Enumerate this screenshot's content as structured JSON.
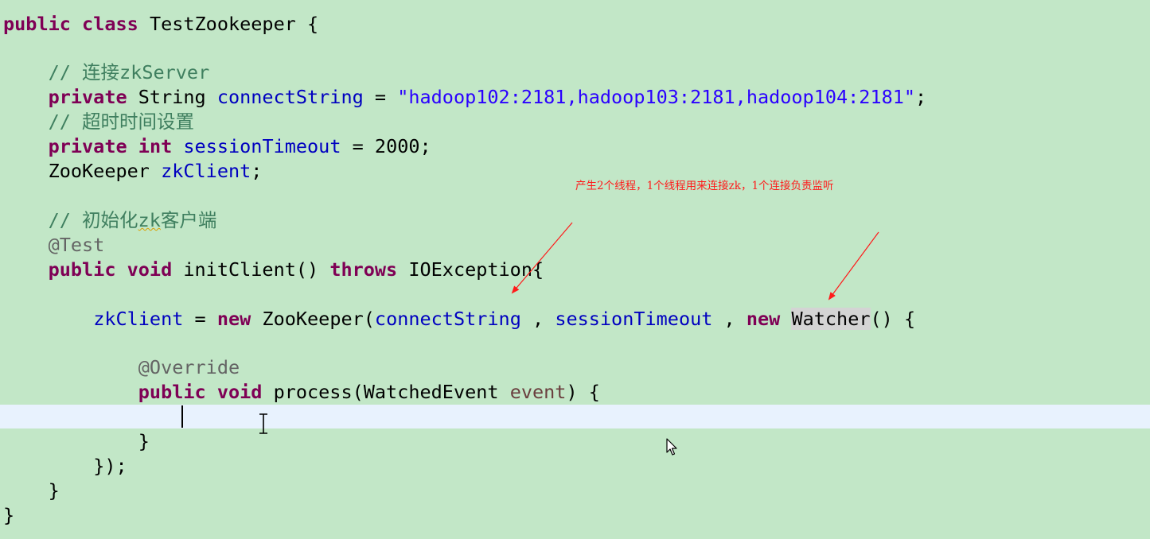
{
  "code": {
    "l1": {
      "kw_public": "public",
      "kw_class": "class",
      "name": " TestZookeeper {"
    },
    "l3": {
      "comment": "// 连接zkServer"
    },
    "l4": {
      "kw_private": "private",
      "type": " String ",
      "field": "connectString",
      "eq": " = ",
      "value": "\"hadoop102:2181,hadoop103:2181,hadoop104:2181\"",
      "end": ";"
    },
    "l5": {
      "comment": "// 超时时间设置"
    },
    "l6": {
      "kw_private": "private",
      "kw_int": "int",
      "field": "sessionTimeout",
      "rest": " = 2000;"
    },
    "l7": {
      "type": "ZooKeeper ",
      "field": "zkClient",
      "end": ";"
    },
    "l9": {
      "comment_a": "// 初始化",
      "comment_b": "zk",
      "comment_c": "客户端"
    },
    "l10": {
      "annotation": "@Test"
    },
    "l11": {
      "kw_public": "public",
      "kw_void": "void",
      "method": " initClient() ",
      "kw_throws": "throws",
      "rest": " IOException{"
    },
    "l13": {
      "field": "zkClient",
      "eq": " = ",
      "kw_new": "new",
      "cls": " ZooKeeper(",
      "arg1": "connectString",
      "comma1": " , ",
      "arg2": "sessionTimeout",
      "comma2": " , ",
      "kw_new2": "new",
      "watcher": "Watcher",
      "end": "() {"
    },
    "l15": {
      "annotation": "@Override"
    },
    "l16": {
      "kw_public": "public",
      "kw_void": "void",
      "method": " process(WatchedEvent ",
      "param": "event",
      "end": ") {"
    },
    "l18": {
      "text": "}"
    },
    "l19": {
      "text": "});"
    },
    "l20": {
      "text": "}"
    },
    "l21": {
      "text": "}"
    }
  },
  "annotation_note": "产生2个线程，1个线程用来连接zk，1个连接负责监听",
  "colors": {
    "background": "#c2e7c7",
    "keyword": "#7f0055",
    "field": "#0000c0",
    "string": "#2a00ff",
    "comment": "#3f7f5f",
    "annotation": "#646464",
    "current_line": "#e8f2fe",
    "note": "#ff1a1a"
  },
  "icons": {
    "text_cursor": "ibeam-cursor-icon",
    "mouse_pointer": "arrow-pointer-icon"
  }
}
